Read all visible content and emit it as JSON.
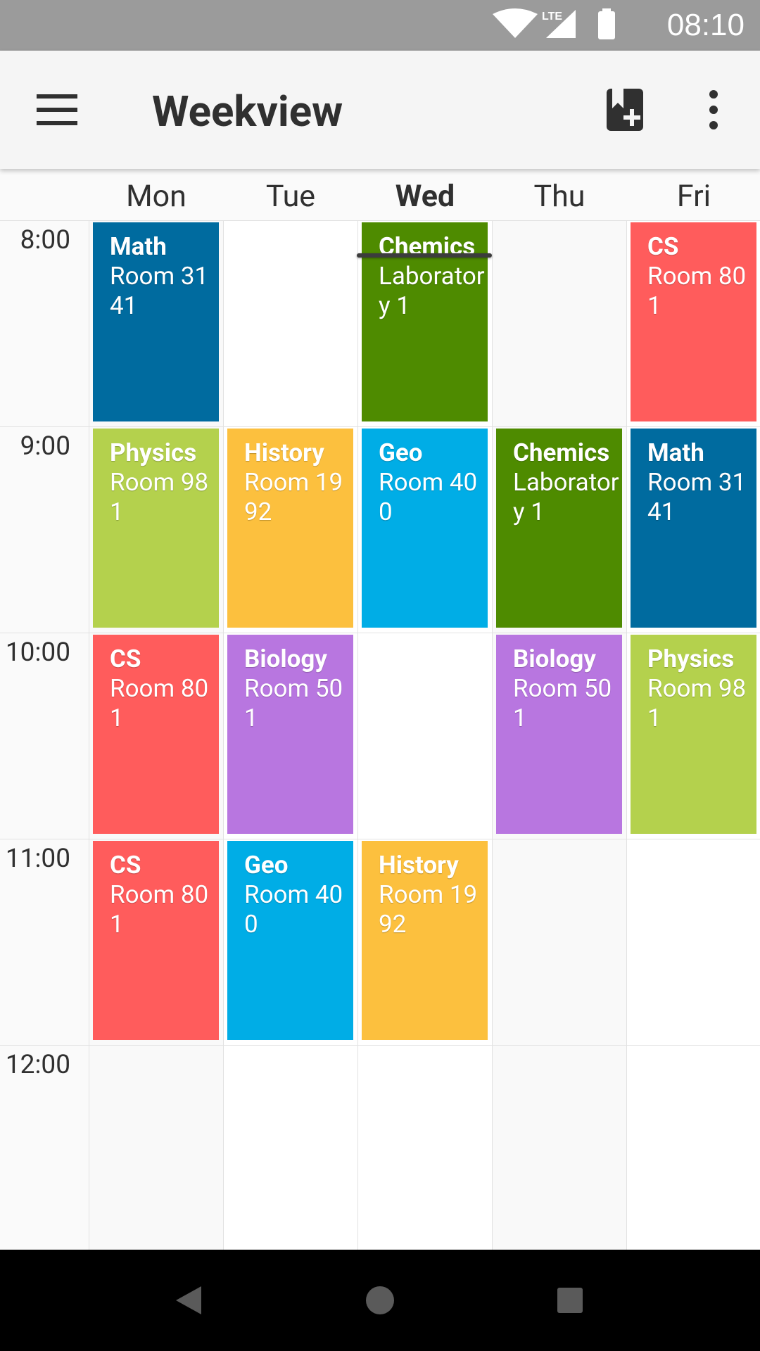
{
  "status_bar": {
    "time": "08:10",
    "network_label": "LTE"
  },
  "app_bar": {
    "title": "Weekview",
    "menu_icon": "hamburger-menu-icon",
    "add_icon": "add-bookmark-icon",
    "more_icon": "more-vertical-icon"
  },
  "days": [
    "Mon",
    "Tue",
    "Wed",
    "Thu",
    "Fri"
  ],
  "today_index": 2,
  "times": [
    "8:00",
    "9:00",
    "10:00",
    "11:00",
    "12:00"
  ],
  "colors": {
    "math": "#006b9f",
    "cs": "#ff5c5c",
    "chemics": "#4e8b00",
    "physics": "#b4d14d",
    "history": "#fcc03e",
    "geo": "#00ade6",
    "biology": "#b876e0",
    "col_today": "#ffffff",
    "col_other": "#f9f9f9"
  },
  "lessons": [
    {
      "day": 0,
      "slot": 0,
      "subject": "Math",
      "room": "Room 3141",
      "color": "#006b9f"
    },
    {
      "day": 2,
      "slot": 0,
      "subject": "Chemics",
      "room": "Laboratory 1",
      "color": "#4e8b00"
    },
    {
      "day": 4,
      "slot": 0,
      "subject": "CS",
      "room": "Room 801",
      "color": "#ff5c5c"
    },
    {
      "day": 0,
      "slot": 1,
      "subject": "Physics",
      "room": "Room 981",
      "color": "#b4d14d"
    },
    {
      "day": 1,
      "slot": 1,
      "subject": "History",
      "room": "Room 1992",
      "color": "#fcc03e"
    },
    {
      "day": 2,
      "slot": 1,
      "subject": "Geo",
      "room": "Room 400",
      "color": "#00ade6"
    },
    {
      "day": 3,
      "slot": 1,
      "subject": "Chemics",
      "room": "Laboratory 1",
      "color": "#4e8b00"
    },
    {
      "day": 4,
      "slot": 1,
      "subject": "Math",
      "room": "Room 3141",
      "color": "#006b9f"
    },
    {
      "day": 0,
      "slot": 2,
      "subject": "CS",
      "room": "Room 801",
      "color": "#ff5c5c"
    },
    {
      "day": 1,
      "slot": 2,
      "subject": "Biology",
      "room": "Room 501",
      "color": "#b876e0"
    },
    {
      "day": 3,
      "slot": 2,
      "subject": "Biology",
      "room": "Room 501",
      "color": "#b876e0"
    },
    {
      "day": 4,
      "slot": 2,
      "subject": "Physics",
      "room": "Room 981",
      "color": "#b4d14d"
    },
    {
      "day": 0,
      "slot": 3,
      "subject": "CS",
      "room": "Room 801",
      "color": "#ff5c5c"
    },
    {
      "day": 1,
      "slot": 3,
      "subject": "Geo",
      "room": "Room 400",
      "color": "#00ade6"
    },
    {
      "day": 2,
      "slot": 3,
      "subject": "History",
      "room": "Room 1992",
      "color": "#fcc03e"
    }
  ],
  "navigation": {
    "back_icon": "back-triangle-icon",
    "home_icon": "home-circle-icon",
    "recents_icon": "recents-square-icon"
  }
}
